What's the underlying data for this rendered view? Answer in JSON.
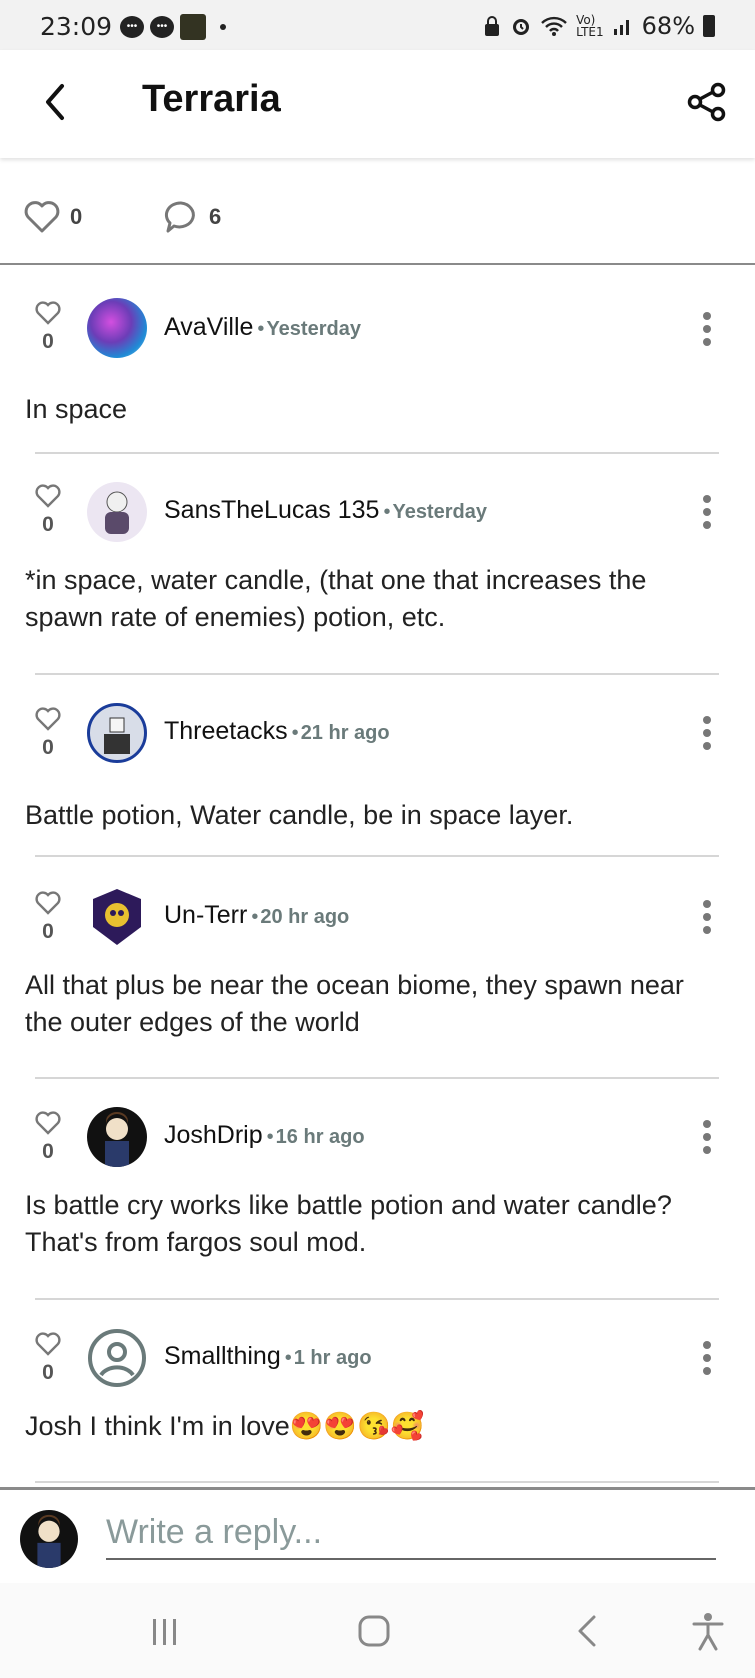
{
  "status_bar": {
    "time": "23:09",
    "network_top": "Vo)",
    "network_bottom": "LTE1",
    "battery": "68%"
  },
  "header": {
    "title": "Terraria",
    "back_icon": "chevron-left-icon",
    "share_icon": "share-icon"
  },
  "stats": {
    "likes": "0",
    "comments": "6"
  },
  "comments": [
    {
      "user": "AvaVille",
      "time": "Yesterday",
      "likes": "0",
      "text": "In space"
    },
    {
      "user": "SansTheLucas 135",
      "time": "Yesterday",
      "likes": "0",
      "text": "*in space, water candle, (that one that increases the spawn rate of enemies) potion, etc."
    },
    {
      "user": "Threetacks",
      "time": "21 hr ago",
      "likes": "0",
      "text": "Battle potion, Water candle, be in space layer."
    },
    {
      "user": "Un-Terr",
      "time": "20 hr ago",
      "likes": "0",
      "text": "All that plus be near the ocean biome, they spawn near the outer edges of the world"
    },
    {
      "user": "JoshDrip",
      "time": "16 hr ago",
      "likes": "0",
      "text": "Is battle cry works like battle potion and water candle? That's from fargos soul mod."
    },
    {
      "user": "Smallthing",
      "time": "1 hr ago",
      "likes": "0",
      "text": "Josh I think I'm in love😍😍😘🥰"
    }
  ],
  "reply": {
    "placeholder": "Write a reply..."
  },
  "colors": {
    "accent_gray": "#6a7a7a",
    "divider": "#d6d6d6"
  }
}
